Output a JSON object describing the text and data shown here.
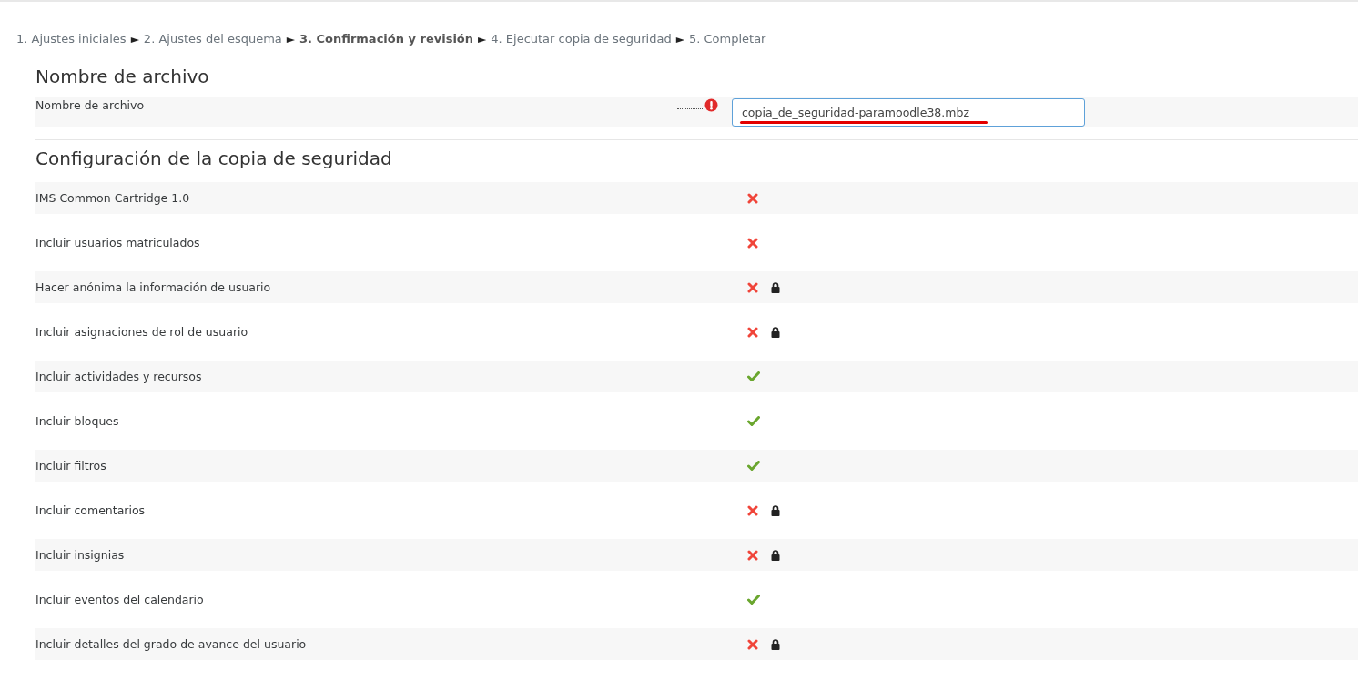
{
  "steps": [
    {
      "label": "1. Ajustes iniciales",
      "selected": false
    },
    {
      "label": "2. Ajustes del esquema",
      "selected": false
    },
    {
      "label": "3. Confirmación y revisión",
      "selected": true
    },
    {
      "label": "4. Ejecutar copia de seguridad",
      "selected": false
    },
    {
      "label": "5. Completar",
      "selected": false
    }
  ],
  "step_separator": "►",
  "filename_section": {
    "heading": "Nombre de archivo",
    "label": "Nombre de archivo",
    "required": true,
    "value": "copia_de_seguridad-paramoodle38.mbz"
  },
  "settings_section": {
    "heading": "Configuración de la copia de seguridad",
    "rows": [
      {
        "label": "IMS Common Cartridge 1.0",
        "enabled": false,
        "locked": false
      },
      {
        "label": "Incluir usuarios matriculados",
        "enabled": false,
        "locked": false
      },
      {
        "label": "Hacer anónima la información de usuario",
        "enabled": false,
        "locked": true
      },
      {
        "label": "Incluir asignaciones de rol de usuario",
        "enabled": false,
        "locked": true
      },
      {
        "label": "Incluir actividades y recursos",
        "enabled": true,
        "locked": false
      },
      {
        "label": "Incluir bloques",
        "enabled": true,
        "locked": false
      },
      {
        "label": "Incluir filtros",
        "enabled": true,
        "locked": false
      },
      {
        "label": "Incluir comentarios",
        "enabled": false,
        "locked": true
      },
      {
        "label": "Incluir insignias",
        "enabled": false,
        "locked": true
      },
      {
        "label": "Incluir eventos del calendario",
        "enabled": true,
        "locked": false
      },
      {
        "label": "Incluir detalles del grado de avance del usuario",
        "enabled": false,
        "locked": true
      }
    ]
  }
}
